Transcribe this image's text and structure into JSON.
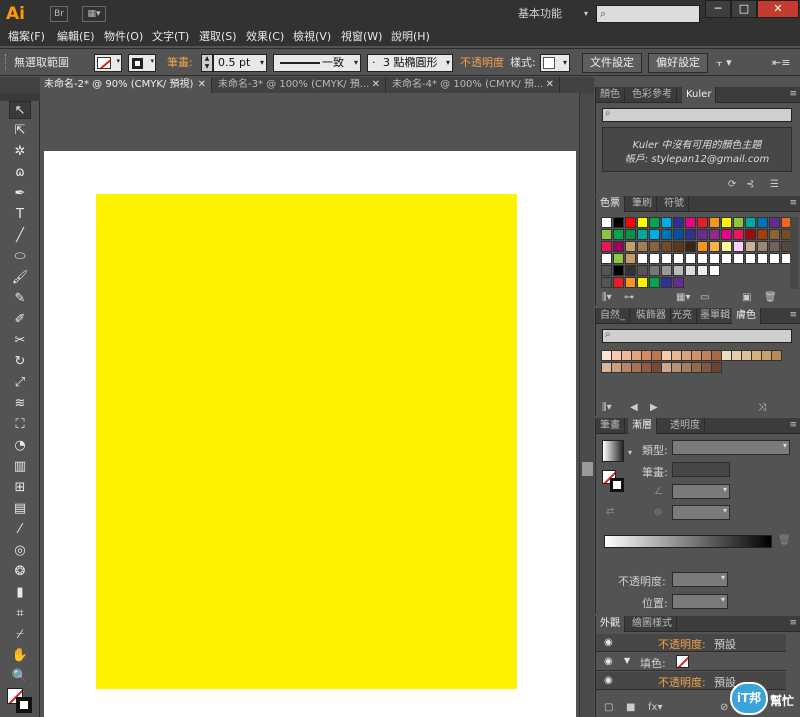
{
  "app": {
    "logo": "Ai",
    "workspace": "基本功能",
    "toolbar_icons": [
      "bridge-icon",
      "arrange-documents-icon"
    ],
    "bridge_label": "Br",
    "window_buttons": [
      "─",
      "□",
      "✕"
    ]
  },
  "menu": [
    "檔案(F)",
    "編輯(E)",
    "物件(O)",
    "文字(T)",
    "選取(S)",
    "效果(C)",
    "檢視(V)",
    "視窗(W)",
    "說明(H)"
  ],
  "control": {
    "selection_label": "無選取範圍",
    "stroke_label": "筆畫:",
    "stroke_weight": "0.5 pt",
    "stroke_profile": "一致",
    "brush": "3 點橢圓形",
    "opacity_label": "不透明度",
    "style_label": "樣式:",
    "doc_setup": "文件設定",
    "preferences": "偏好設定"
  },
  "tabs": [
    {
      "label": "未命名-2* @ 90% (CMYK/ 預視)",
      "active": true
    },
    {
      "label": "未命名-3* @ 100% (CMYK/ 預...",
      "active": false
    },
    {
      "label": "未命名-4* @ 100% (CMYK/ 預...",
      "active": false
    }
  ],
  "tools": [
    "selection-tool-icon",
    "direct-selection-tool-icon",
    "magic-wand-icon",
    "lasso-icon",
    "pen-tool-icon",
    "type-tool-icon",
    "line-tool-icon",
    "ellipse-tool-icon",
    "paintbrush-icon",
    "pencil-icon",
    "blob-brush-icon",
    "scissors-icon",
    "rotate-tool-icon",
    "scale-tool-icon",
    "warp-tool-icon",
    "free-transform-icon",
    "shape-builder-icon",
    "perspective-grid-icon",
    "mesh-tool-icon",
    "gradient-tool-icon",
    "eyedropper-icon",
    "blend-tool-icon",
    "symbol-sprayer-icon",
    "column-graph-icon",
    "artboard-tool-icon",
    "slice-tool-icon",
    "hand-tool-icon",
    "zoom-tool-icon"
  ],
  "kuler": {
    "tabs": [
      "顏色",
      "色彩參考",
      "Kuler"
    ],
    "message": "Kuler 中沒有可用的顏色主題",
    "account": "帳戶: stylepan12@gmail.com"
  },
  "swatches_panel": {
    "tabs": [
      "色票",
      "筆刷",
      "符號"
    ]
  },
  "lib_panel": {
    "tabs": [
      "自然_",
      "裝飾器",
      "光亮",
      "墨單輯",
      "膚色"
    ]
  },
  "gradient_panel": {
    "tabs": [
      "筆畫",
      "漸層",
      "透明度"
    ],
    "type_label": "類型:",
    "stroke_label": "筆畫:",
    "opacity_label": "不透明度:",
    "position_label": "位置:"
  },
  "appearance_panel": {
    "tabs": [
      "外觀",
      "繪圖樣式"
    ],
    "rows": [
      {
        "label": "不透明度:",
        "value": "預設"
      },
      {
        "label": "填色:",
        "value": ""
      },
      {
        "label": "不透明度:",
        "value": "預設"
      }
    ]
  },
  "watermark": {
    "brand": "iT邦",
    "sub": "幫忙"
  },
  "colors": {
    "accent": "#ff9a00",
    "rect_fill": "#fff200",
    "close_button": "#c43b30"
  }
}
